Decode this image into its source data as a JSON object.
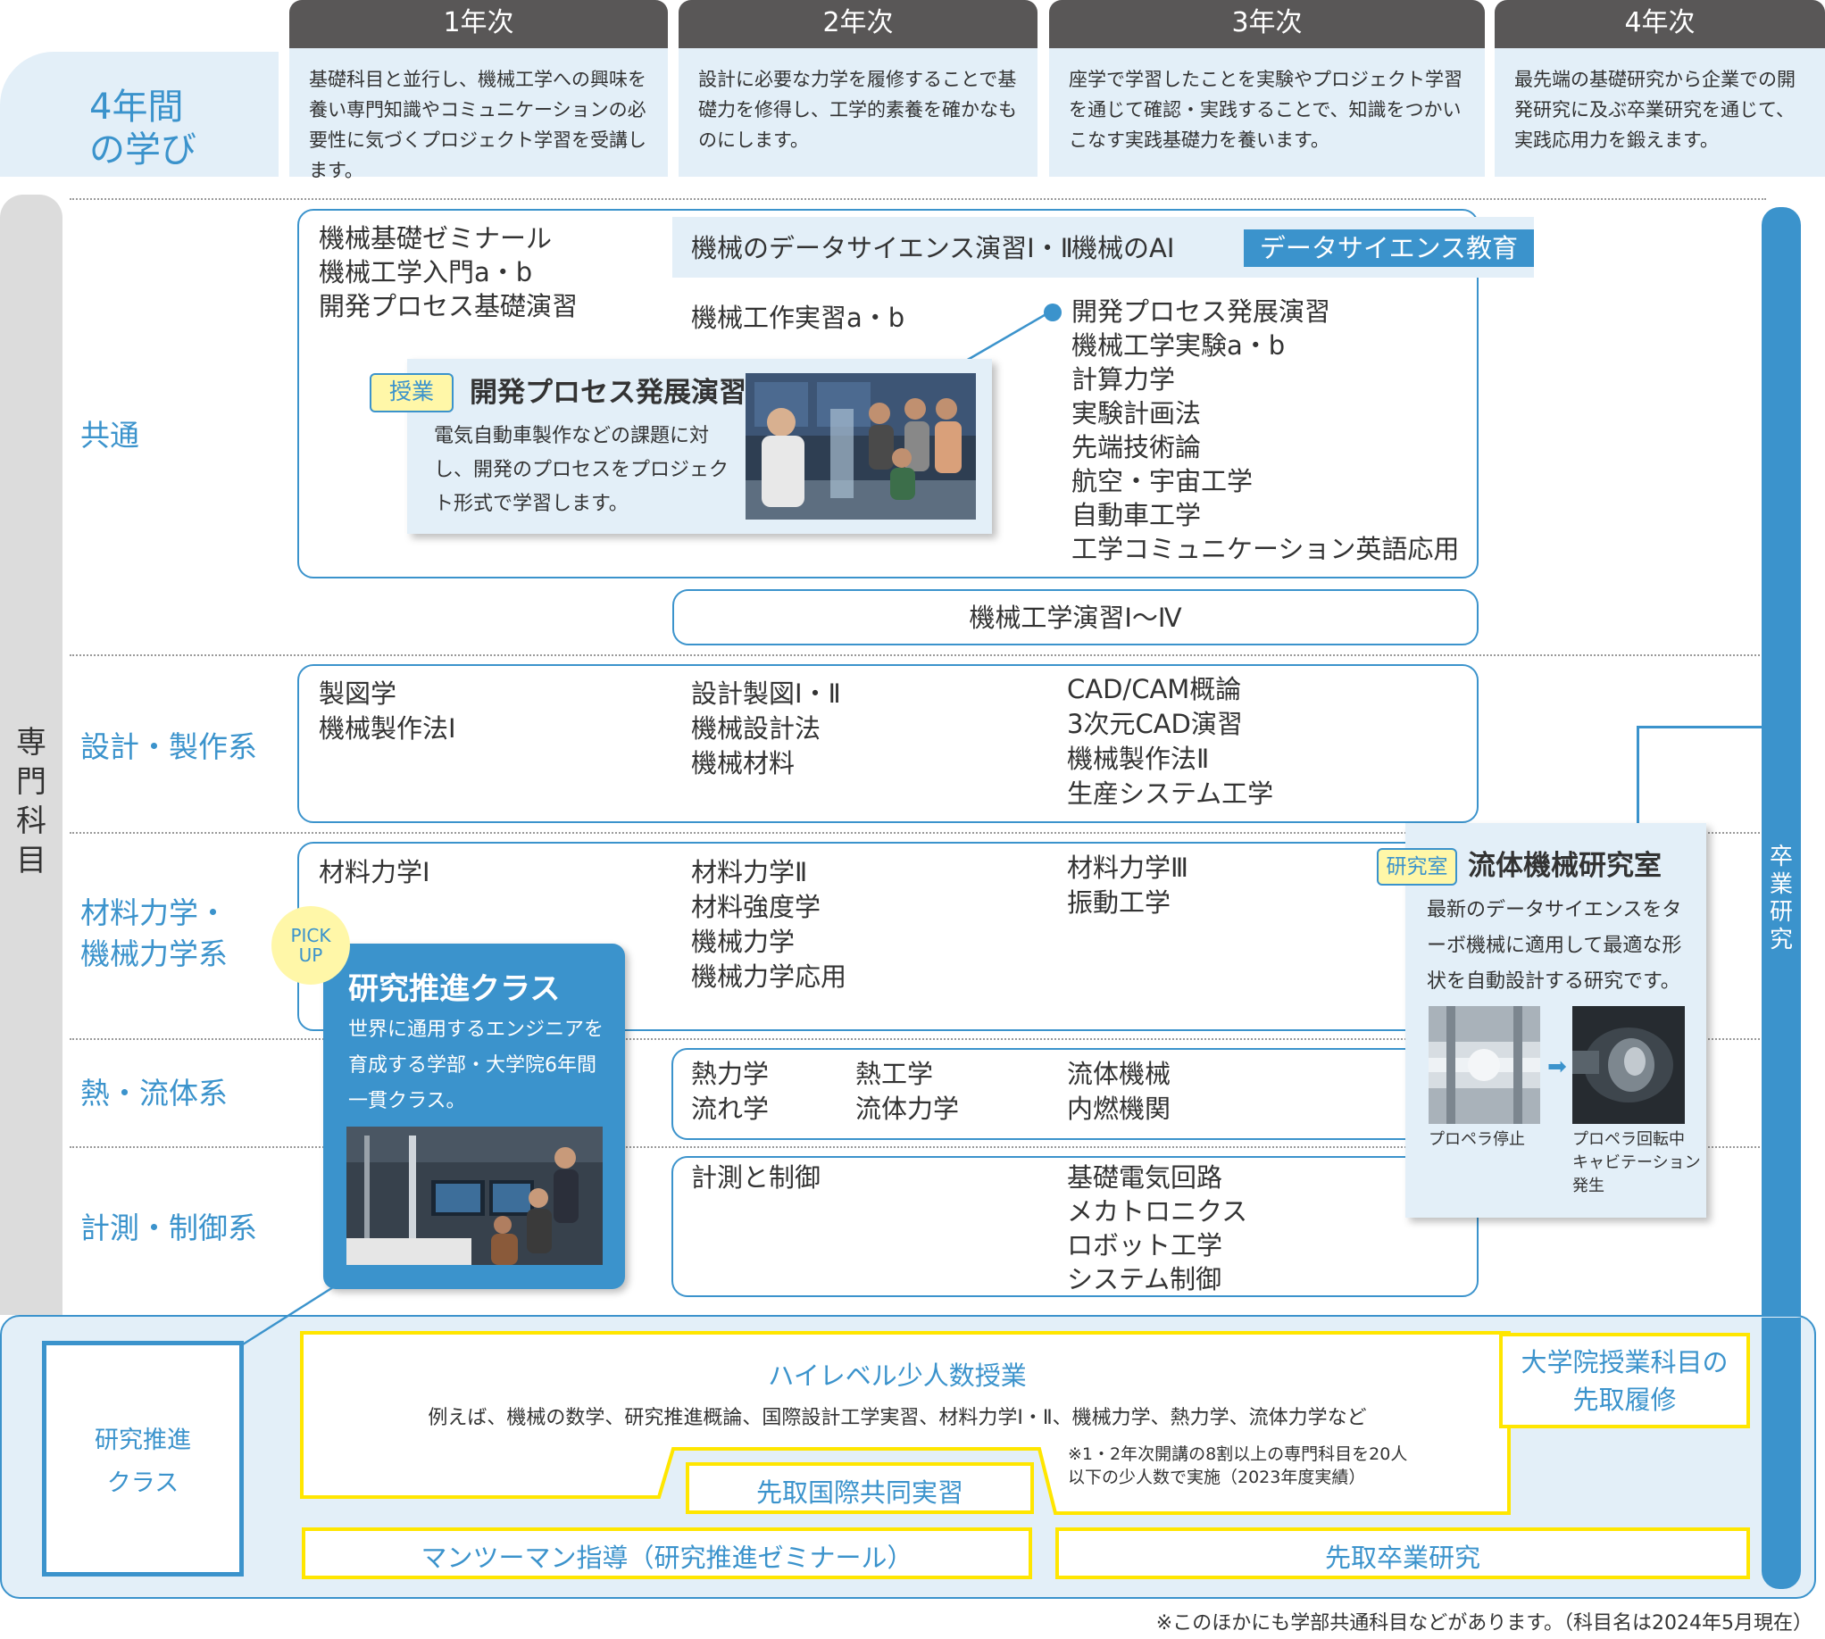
{
  "header": {
    "four_years": "4年間\nの学び",
    "years": [
      {
        "label": "1年次",
        "desc": "基礎科目と並行し、機械工学への興味を養い専門知識やコミュニケーションの必要性に気づくプロジェクト学習を受講します。"
      },
      {
        "label": "2年次",
        "desc": "設計に必要な力学を履修することで基礎力を修得し、工学的素養を確かなものにします。"
      },
      {
        "label": "3年次",
        "desc": "座学で学習したことを実験やプロジェクト学習を通じて確認・実践することで、知識をつかいこなす実践基礎力を養います。"
      },
      {
        "label": "4年次",
        "desc": "最先端の基礎研究から企業での開発研究に及ぶ卒業研究を通じて、実践応用力を鍛えます。"
      }
    ]
  },
  "senmon_label": "専門科目",
  "thesis_label": "卒業研究",
  "categories": {
    "kyotsu": "共通",
    "sekkei": "設計・製作系",
    "zairyo": "材料力学・\n機械力学系",
    "netsu": "熱・流体系",
    "keisoku": "計測・制御系"
  },
  "kyotsu": {
    "y1": [
      "機械基礎ゼミナール",
      "機械工学入門a・b",
      "開発プロセス基礎演習"
    ],
    "ds_band": {
      "y2": "機械のデータサイエンス演習Ⅰ・Ⅱ",
      "y3": "機械のAI",
      "tag": "データサイエンス教育"
    },
    "y2": "機械工作実習a・b",
    "y3": [
      "開発プロセス発展演習",
      "機械工学実験a・b",
      "計算力学",
      "実験計画法",
      "先端技術論",
      "航空・宇宙工学",
      "自動車工学",
      "工学コミュニケーション英語応用"
    ],
    "enshu": "機械工学演習Ⅰ〜Ⅳ"
  },
  "lesson_card": {
    "tag": "授業",
    "title": "開発プロセス発展演習",
    "text": "電気自動車製作などの課題に対し、開発のプロセスをプロジェクト形式で学習します。"
  },
  "sekkei": {
    "y1": [
      "製図学",
      "機械製作法Ⅰ"
    ],
    "y2": [
      "設計製図Ⅰ・Ⅱ",
      "機械設計法",
      "機械材料"
    ],
    "y3": [
      "CAD/CAM概論",
      "3次元CAD演習",
      "機械製作法Ⅱ",
      "生産システム工学"
    ]
  },
  "zairyo": {
    "y1": [
      "材料力学Ⅰ"
    ],
    "y2": [
      "材料力学Ⅱ",
      "材料強度学",
      "機械力学",
      "機械力学応用"
    ],
    "y3": [
      "材料力学Ⅲ",
      "振動工学"
    ]
  },
  "netsu": {
    "c1": [
      "熱力学",
      "流れ学"
    ],
    "c2": [
      "熱工学",
      "流体力学"
    ],
    "c3": [
      "流体機械",
      "内燃機関"
    ]
  },
  "keisoku": {
    "y2": [
      "計測と制御"
    ],
    "y3": [
      "基礎電気回路",
      "メカトロニクス",
      "ロボット工学",
      "システム制御"
    ]
  },
  "pickup": {
    "badge": "PICK\nUP",
    "title": "研究推進クラス",
    "text": "世界に通用するエンジニアを育成する学部・大学院6年間一貫クラス。"
  },
  "lab_card": {
    "tag": "研究室",
    "title": "流体機械研究室",
    "text": "最新のデータサイエンスをターボ機械に適用して最適な形状を自動設計する研究です。",
    "cap1": "プロペラ停止",
    "cap2": "プロペラ回転中\nキャビテーション\n発生"
  },
  "research_class": {
    "label": "研究推進\nクラス",
    "high_level_title": "ハイレベル少人数授業",
    "high_level_text": "例えば、機械の数学、研究推進概論、国際設計工学実習、材料力学Ⅰ・Ⅱ、機械力学、熱力学、流体力学など",
    "note": "※1・2年次開講の8割以上の専門科目を20人\n以下の少人数で実施（2023年度実績）",
    "intl": "先取国際共同実習",
    "grad": "大学院授業科目の\n先取履修",
    "mentor": "マンツーマン指導（研究推進ゼミナール）",
    "thesis_early": "先取卒業研究"
  },
  "footnote": "※このほかにも学部共通科目などがあります。（科目名は2024年5月現在）",
  "colors": {
    "accent": "#3b93cc",
    "light": "#e3eff8",
    "yellow": "#ffe600",
    "header_gray": "#595757"
  }
}
